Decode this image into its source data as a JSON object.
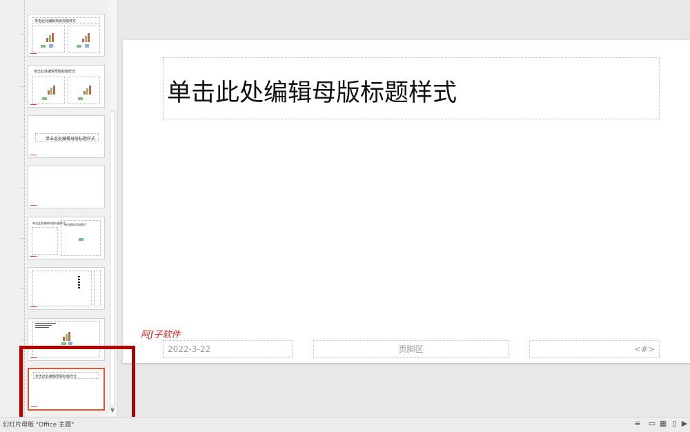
{
  "slide": {
    "title": "单击此处编辑母版标题样式",
    "date": "2022-3-22",
    "footer": "页脚区",
    "number": "<#>",
    "watermark": "阿J子软件"
  },
  "thumbnails": [
    {
      "caption": "单击此处编辑母版标题样式",
      "selected": false
    },
    {
      "caption": "单击此处编辑母版标题样式",
      "selected": false
    },
    {
      "caption": "单击此处编辑母版标题样式",
      "selected": false
    },
    {
      "caption": "",
      "selected": false
    },
    {
      "caption": "单击此处编辑母版标题样式",
      "caption2": "单击图标添加图片",
      "selected": false
    },
    {
      "caption": "",
      "selected": false
    },
    {
      "caption": "",
      "selected": false
    },
    {
      "caption": "单击此处编辑母版标题样式",
      "selected": true
    }
  ],
  "status": {
    "text": "幻灯片母版 \"Office 主题\""
  },
  "colors": {
    "accent_selected": "#e4572e",
    "highlight_box": "#b30000",
    "watermark": "#d81e1e"
  },
  "icons": [
    "notes-icon",
    "normal-view-icon",
    "slide-sorter-icon",
    "reading-view-icon",
    "slideshow-icon"
  ]
}
